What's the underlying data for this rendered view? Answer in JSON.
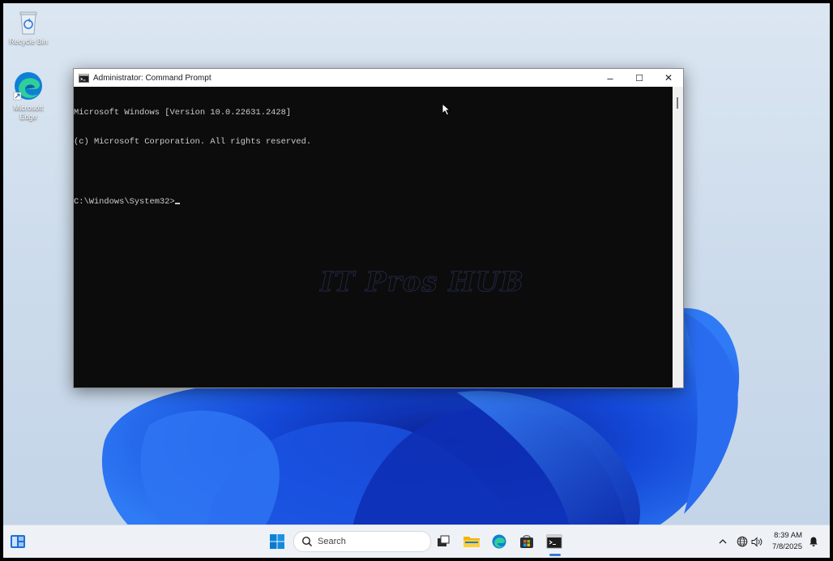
{
  "desktop": {
    "icons": [
      {
        "label": "Recycle Bin",
        "icon": "recycle-bin-icon"
      },
      {
        "label": "Microsoft Edge",
        "icon": "edge-icon"
      }
    ]
  },
  "window": {
    "title": "Administrator: Command Prompt",
    "icon": "cmd-icon",
    "controls": {
      "minimize": "–",
      "maximize": "☐",
      "close": "✕"
    }
  },
  "console": {
    "lines": [
      "Microsoft Windows [Version 10.0.22631.2428]",
      "(c) Microsoft Corporation. All rights reserved.",
      "",
      "C:\\Windows\\System32>"
    ]
  },
  "watermark": "IT Pros HUB",
  "taskbar": {
    "search_label": "Search",
    "pinned": [
      "widgets-icon",
      "start-icon",
      "task-view-icon",
      "file-explorer-icon",
      "edge-icon",
      "store-icon",
      "terminal-icon"
    ],
    "time": "8:39 AM",
    "date": "7/8/2025"
  },
  "colors": {
    "console_bg": "#0c0c0c",
    "console_text": "#cccccc",
    "accent": "#3a7bd5"
  }
}
